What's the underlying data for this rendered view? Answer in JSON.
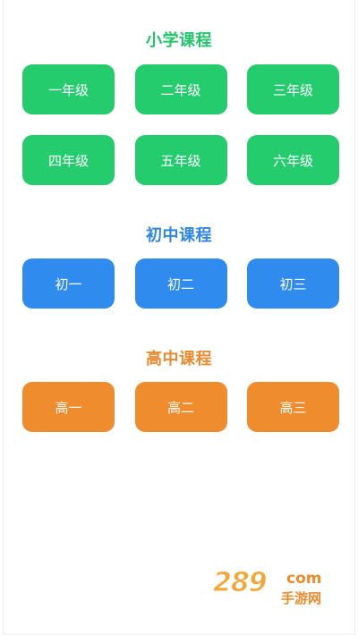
{
  "sections": {
    "primary": {
      "title": "小学课程",
      "items": [
        "一年级",
        "二年级",
        "三年级",
        "四年级",
        "五年级",
        "六年级"
      ]
    },
    "junior": {
      "title": "初中课程",
      "items": [
        "初一",
        "初二",
        "初三"
      ]
    },
    "senior": {
      "title": "高中课程",
      "items": [
        "高一",
        "高二",
        "高三"
      ]
    }
  },
  "watermark": {
    "number": "289",
    "suffix": "com",
    "tagline": "手游网"
  },
  "colors": {
    "primary": "#25cc6e",
    "junior": "#2f8cee",
    "senior": "#ef8c2d"
  }
}
